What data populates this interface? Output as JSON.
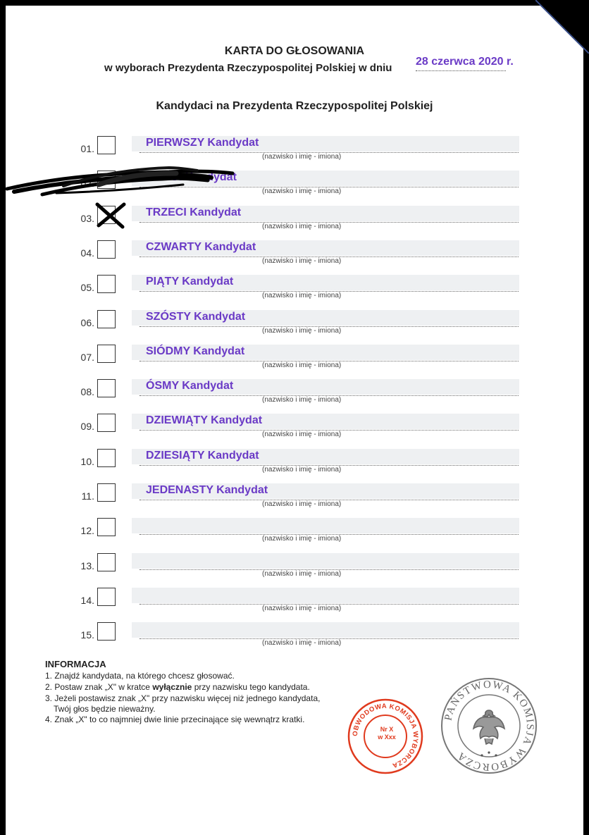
{
  "header": {
    "title": "KARTA DO GŁOSOWANIA",
    "subtitle": "w wyborach Prezydenta Rzeczypospolitej Polskiej w dniu",
    "date": "28 czerwca 2020 r."
  },
  "heading": "Kandydaci na Prezydenta Rzeczypospolitej Polskiej",
  "hint_text": "(nazwisko i imię - imiona)",
  "candidates": [
    {
      "number": "01.",
      "name": "PIERWSZY Kandydat"
    },
    {
      "number": "02.",
      "name": "DRUGI Kandydat"
    },
    {
      "number": "03.",
      "name": "TRZECI Kandydat"
    },
    {
      "number": "04.",
      "name": "CZWARTY Kandydat"
    },
    {
      "number": "05.",
      "name": "PIĄTY Kandydat"
    },
    {
      "number": "06.",
      "name": "SZÓSTY Kandydat"
    },
    {
      "number": "07.",
      "name": "SIÓDMY Kandydat"
    },
    {
      "number": "08.",
      "name": "ÓSMY Kandydat"
    },
    {
      "number": "09.",
      "name": "DZIEWIĄTY Kandydat"
    },
    {
      "number": "10.",
      "name": "DZIESIĄTY Kandydat"
    },
    {
      "number": "11.",
      "name": "JEDENASTY Kandydat"
    },
    {
      "number": "12.",
      "name": ""
    },
    {
      "number": "13.",
      "name": ""
    },
    {
      "number": "14.",
      "name": ""
    },
    {
      "number": "15.",
      "name": ""
    }
  ],
  "marked_candidate": "03.",
  "info": {
    "title": "INFORMACJA",
    "line1": "1. Znajdź kandydata, na którego chcesz głosować.",
    "line2_a": "2. Postaw znak „X\" w kratce ",
    "line2_b": "wyłącznie",
    "line2_c": " przy nazwisku tego kandydata.",
    "line3": "3. Jeżeli postawisz znak „X\" przy nazwisku więcej niż jednego kandydata,",
    "line3b": "Twój głos będzie nieważny.",
    "line4": "4. Znak „X\" to co najmniej dwie linie przecinające się wewnątrz kratki."
  },
  "stamps": {
    "red_ring": "OBWODOWA KOMISJA WYBORCZA",
    "red_center_1": "Nr X",
    "red_center_2": "w Xxx",
    "gray_ring": "PAŃSTWOWA KOMISJA WYBORCZA"
  },
  "colors": {
    "accent": "#6a3ac6",
    "stamp_red": "#e03a1e",
    "stamp_gray": "#777777"
  }
}
